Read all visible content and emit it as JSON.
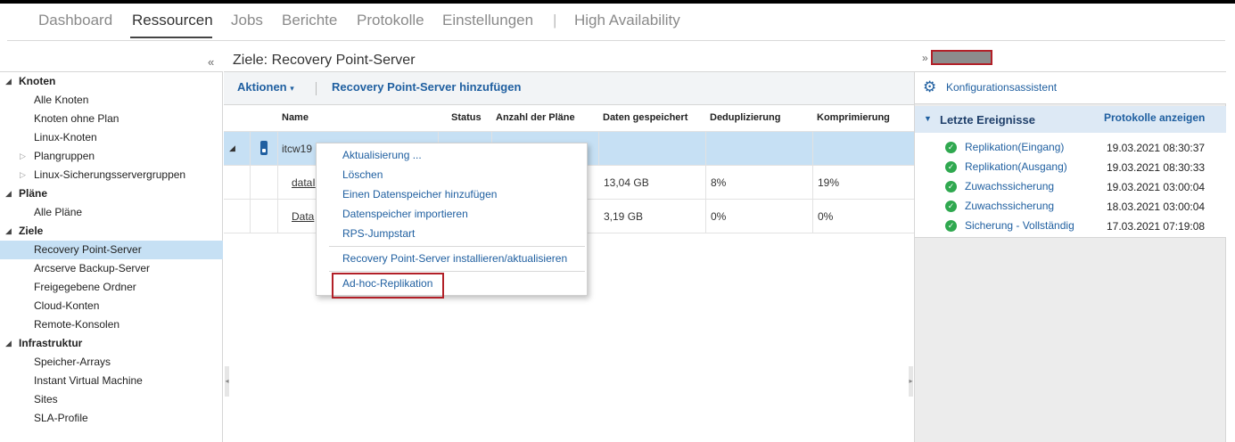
{
  "nav": {
    "tabs": [
      "Dashboard",
      "Ressourcen",
      "Jobs",
      "Berichte",
      "Protokolle",
      "Einstellungen"
    ],
    "separator": "|",
    "extra": "High Availability",
    "active": "Ressourcen"
  },
  "page": {
    "title": "Ziele: Recovery Point-Server",
    "collapse_icon": "«",
    "expand_icon": "»"
  },
  "tree": {
    "sections": [
      {
        "label": "Knoten",
        "items": [
          "Alle Knoten",
          "Knoten ohne Plan",
          "Linux-Knoten",
          "Plangruppen",
          "Linux-Sicherungsservergruppen"
        ]
      },
      {
        "label": "Pläne",
        "items": [
          "Alle Pläne"
        ]
      },
      {
        "label": "Ziele",
        "items": [
          "Recovery Point-Server",
          "Arcserve Backup-Server",
          "Freigegebene Ordner",
          "Cloud-Konten",
          "Remote-Konsolen"
        ]
      },
      {
        "label": "Infrastruktur",
        "items": [
          "Speicher-Arrays",
          "Instant Virtual Machine",
          "Sites",
          "SLA-Profile"
        ]
      }
    ],
    "selected": "Recovery Point-Server"
  },
  "toolbar": {
    "actions_label": "Aktionen",
    "actions_caret": "▾",
    "add_label": "Recovery Point-Server hinzufügen"
  },
  "table": {
    "columns": [
      "Name",
      "Status",
      "Anzahl der Pläne",
      "Daten gespeichert",
      "Deduplizierung",
      "Komprimierung"
    ],
    "server_row": {
      "name": "itcw19"
    },
    "store_rows": [
      {
        "name": "dataI",
        "stored": "13,04 GB",
        "dedup": "8%",
        "compression": "19%"
      },
      {
        "name": "Data",
        "stored": "3,19 GB",
        "dedup": "0%",
        "compression": "0%"
      }
    ]
  },
  "context_menu": {
    "items": [
      "Aktualisierung ...",
      "Löschen",
      "Einen Datenspeicher hinzufügen",
      "Datenspeicher importieren",
      "RPS-Jumpstart"
    ],
    "install_item": "Recovery Point-Server installieren/aktualisieren",
    "adhoc_item": "Ad-hoc-Replikation"
  },
  "right_panel": {
    "assistant_label": "Konfigurationsassistent",
    "events_title": "Letzte Ereignisse",
    "events_link": "Protokolle anzeigen",
    "events": [
      {
        "name": "Replikation(Eingang)",
        "time": "19.03.2021 08:30:37"
      },
      {
        "name": "Replikation(Ausgang)",
        "time": "19.03.2021 08:30:33"
      },
      {
        "name": "Zuwachssicherung",
        "time": "19.03.2021 03:00:04"
      },
      {
        "name": "Zuwachssicherung",
        "time": "18.03.2021 03:00:04"
      },
      {
        "name": "Sicherung - Vollständig",
        "time": "17.03.2021 07:19:08"
      }
    ]
  },
  "colors": {
    "link": "#1f5fa0",
    "selection": "#c6e0f4",
    "highlight_box": "#b22028",
    "success": "#2fa84f"
  }
}
